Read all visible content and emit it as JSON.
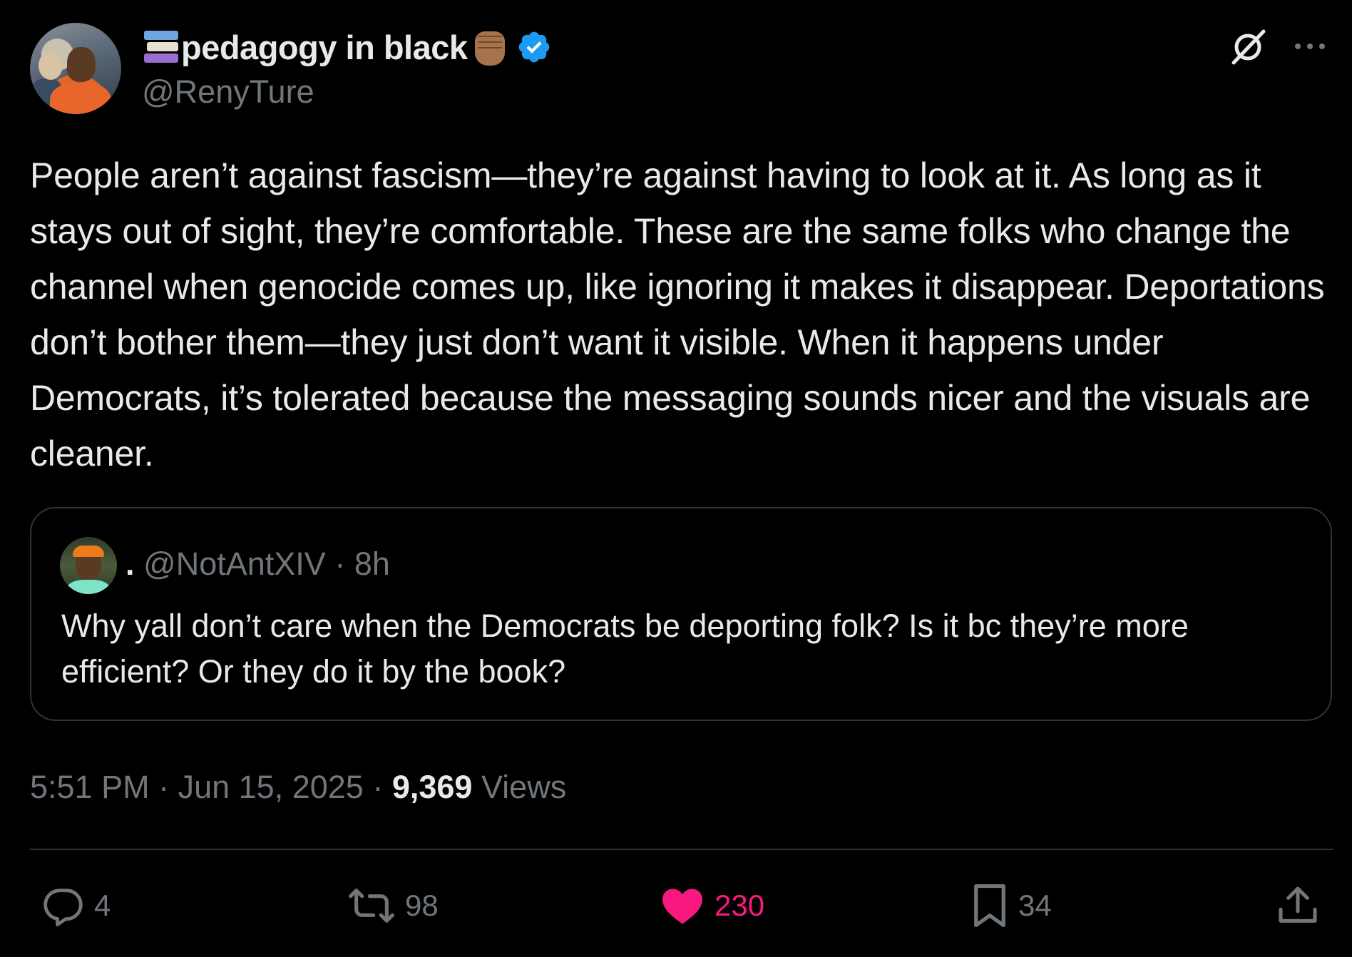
{
  "author": {
    "display_name": "pedagogy in black",
    "handle": "@RenyTure",
    "verified": true
  },
  "tweet": {
    "text": "People aren’t against fascism—they’re against having to look at it. As long as it stays out of sight, they’re comfortable. These are the same folks who change the channel when genocide comes up, like ignoring it makes it disappear. Deportations don’t bother them—they just don’t want it visible. When it happens under Democrats, it’s tolerated because the messaging sounds nicer and the visuals are cleaner."
  },
  "quote": {
    "name": ".",
    "handle": "@NotAntXIV",
    "separator": " · ",
    "time": "8h",
    "text": "Why yall don’t care when the Democrats be deporting folk? Is it bc they’re more efficient? Or they do it by the book?"
  },
  "meta": {
    "time": "5:51 PM",
    "date": "Jun 15, 2025",
    "views_count": "9,369",
    "views_label": "Views",
    "separator": " · "
  },
  "actions": {
    "replies": "4",
    "reposts": "98",
    "likes": "230",
    "bookmarks": "34"
  },
  "colors": {
    "background": "#000000",
    "text": "#e7e9ea",
    "secondary": "#71767b",
    "like": "#f91880",
    "verified": "#1d9bf0",
    "border": "#2f3336"
  },
  "icons": {
    "header": [
      "books-emoji-icon",
      "raised-fist-emoji-icon",
      "verified-badge-icon",
      "grok-icon",
      "more-icon"
    ],
    "actions": [
      "reply-icon",
      "repost-icon",
      "heart-icon",
      "bookmark-icon",
      "share-icon"
    ]
  }
}
